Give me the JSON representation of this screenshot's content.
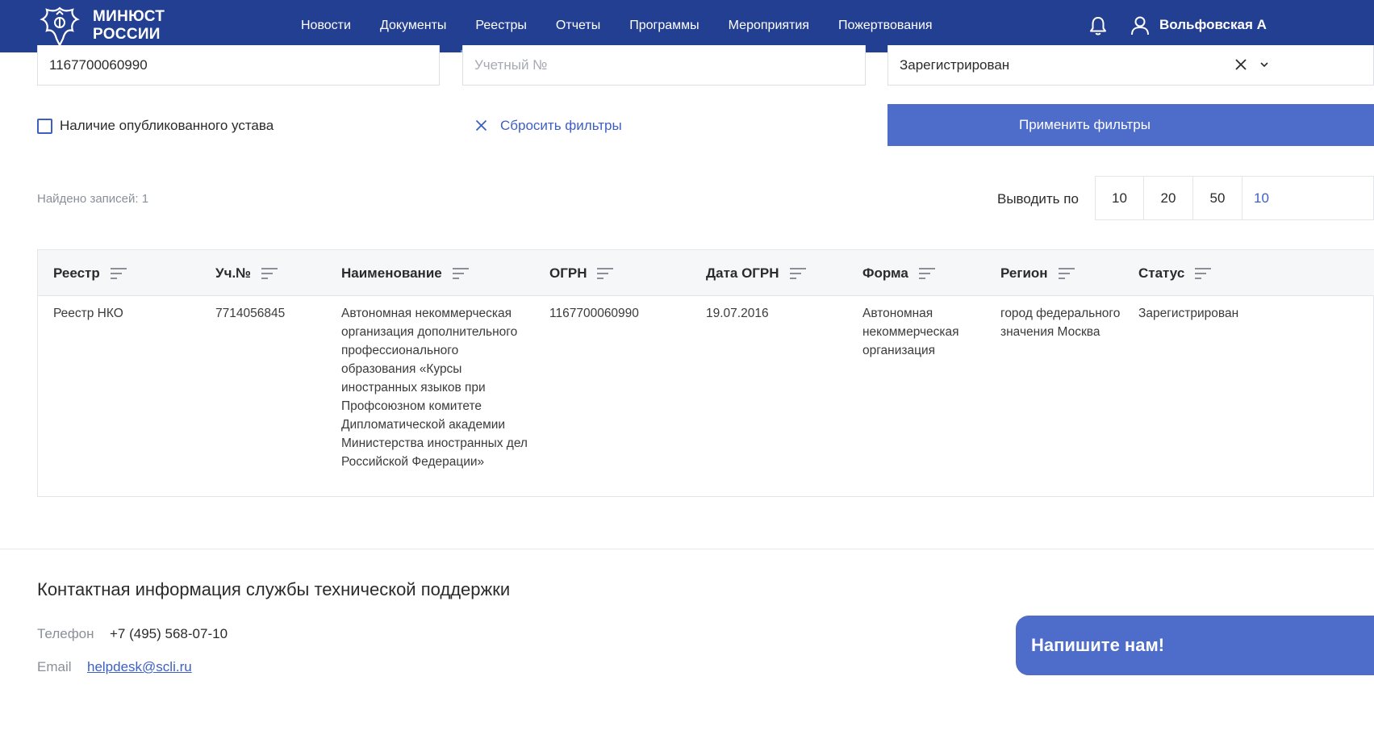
{
  "header": {
    "brand_line1": "МИНЮСТ",
    "brand_line2": "РОССИИ",
    "nav": [
      "Новости",
      "Документы",
      "Реестры",
      "Отчеты",
      "Программы",
      "Мероприятия",
      "Пожертвования"
    ],
    "active_nav": "Реестры",
    "user_name": "Вольфовская А",
    "icons": [
      "eagle-logo-icon",
      "bell-icon",
      "user-icon"
    ]
  },
  "filters": {
    "ogrn_value": "1167700060990",
    "account_placeholder": "Учетный №",
    "status_value": "Зарегистрирован",
    "charter_checkbox_label": "Наличие опубликованного устава",
    "reset_label": "Сбросить фильтры",
    "apply_label": "Применить фильтры"
  },
  "results": {
    "found_label": "Найдено записей:",
    "found_count": "1",
    "per_page_label": "Выводить по",
    "per_page_options": [
      "10",
      "20",
      "50",
      "10"
    ]
  },
  "table": {
    "columns": [
      "Реестр",
      "Уч.№",
      "Наименование",
      "ОГРН",
      "Дата ОГРН",
      "Форма",
      "Регион",
      "Статус"
    ],
    "rows": [
      {
        "registry": "Реестр НКО",
        "account_no": "7714056845",
        "name": "Автономная некоммерческая организация дополнительного профессионального образования «Курсы иностранных языков при Профсоюзном комитете Дипломатической академии Министерства иностранных дел Российской Федерации»",
        "ogrn": "1167700060990",
        "ogrn_date": "19.07.2016",
        "form": "Автономная некоммерческая организация",
        "region": "город федерального значения Москва",
        "status": "Зарегистрирован"
      }
    ]
  },
  "footer": {
    "contact_title": "Контактная информация службы технической поддержки",
    "phone_label": "Телефон",
    "phone_value": "+7 (495) 568-07-10",
    "email_label": "Email",
    "email_value": "helpdesk@scli.ru",
    "chat_button": "Напишите нам!"
  },
  "colors": {
    "header_bg": "#233f91",
    "accent": "#4e6cc9",
    "link": "#3d5fc4"
  }
}
